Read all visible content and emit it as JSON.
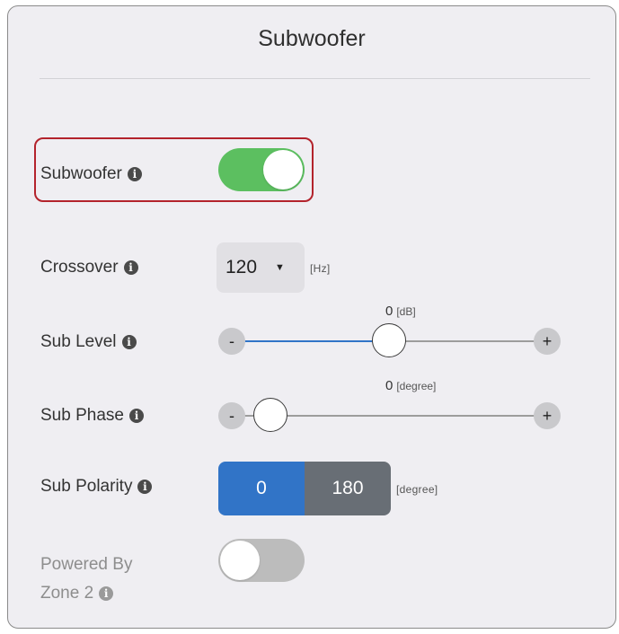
{
  "panel": {
    "title": "Subwoofer"
  },
  "subwoofer": {
    "label": "Subwoofer",
    "info_icon": "info-icon",
    "enabled": true,
    "accent": "#5cbf60",
    "highlight_color": "#b3232c"
  },
  "crossover": {
    "label": "Crossover",
    "value": "120",
    "caret": "▼",
    "unit": "[Hz]"
  },
  "sub_level": {
    "label": "Sub Level",
    "value": "0",
    "unit": "[dB]",
    "minus": "-",
    "plus": "+",
    "fill_color": "#3174c7"
  },
  "sub_phase": {
    "label": "Sub Phase",
    "value": "0",
    "unit": "[degree]",
    "minus": "-",
    "plus": "+"
  },
  "sub_polarity": {
    "label": "Sub Polarity",
    "options": [
      "0",
      "180"
    ],
    "selected": "0",
    "unit": "[degree]",
    "selected_color": "#3174c7",
    "unselected_color": "#686e75"
  },
  "powered_by_zone2": {
    "label_line1": "Powered By",
    "label_line2": "Zone 2",
    "enabled": false
  }
}
